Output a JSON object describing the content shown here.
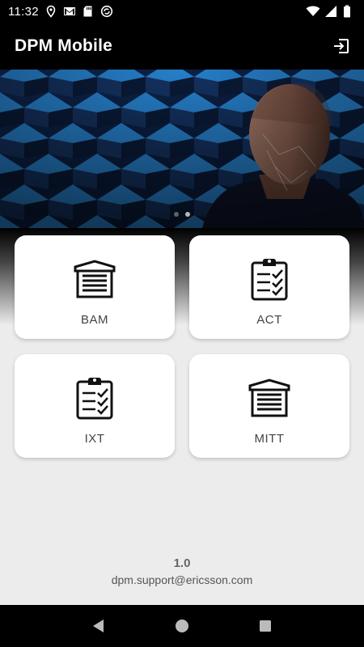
{
  "status_bar": {
    "time": "11:32",
    "icons": [
      "location-icon",
      "gmail-icon",
      "sd-card-icon",
      "sync-icon",
      "wifi-icon",
      "signal-icon",
      "battery-icon"
    ]
  },
  "app_bar": {
    "title": "DPM Mobile",
    "logout_icon": "logout-icon"
  },
  "banner": {
    "slides": 2,
    "active_slide": 2
  },
  "tiles": [
    {
      "label": "BAM",
      "icon": "garage-door-icon"
    },
    {
      "label": "ACT",
      "icon": "clipboard-checklist-icon"
    },
    {
      "label": "IXT",
      "icon": "clipboard-checklist-icon"
    },
    {
      "label": "MITT",
      "icon": "garage-door-icon"
    }
  ],
  "footer": {
    "version": "1.0",
    "email": "dpm.support@ericsson.com"
  },
  "nav_bar": {
    "buttons": [
      "back-icon",
      "home-icon",
      "recents-icon"
    ]
  },
  "colors": {
    "bars": "#000000",
    "background": "#ececec",
    "tile": "#ffffff",
    "banner_accent": "#2b8fe0"
  }
}
